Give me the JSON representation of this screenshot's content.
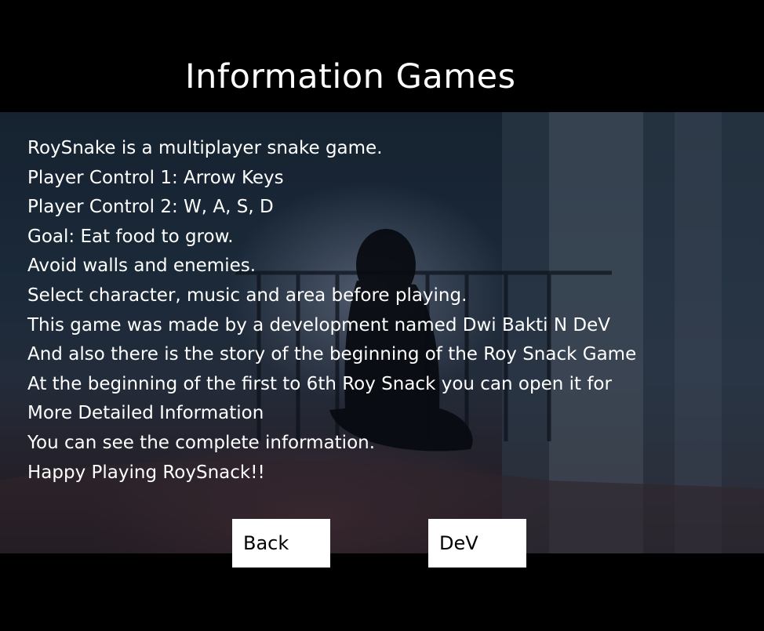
{
  "screen": {
    "title": "Information Games"
  },
  "info": {
    "lines": [
      "RoySnake is a multiplayer snake game.",
      "Player Control 1: Arrow Keys",
      "Player Control 2: W, A, S, D",
      "Goal: Eat food to grow.",
      "Avoid walls and enemies.",
      "Select character, music and area before playing.",
      "This game was made by a development named Dwi Bakti N DeV",
      "And also there is the story of the beginning of the Roy Snack Game",
      "At the beginning of the first to 6th Roy Snack you can open it for",
      "More Detailed Information",
      "You can see the complete information.",
      "Happy Playing RoySnack!!"
    ]
  },
  "buttons": {
    "back_label": "Back",
    "dev_label": "DeV"
  }
}
